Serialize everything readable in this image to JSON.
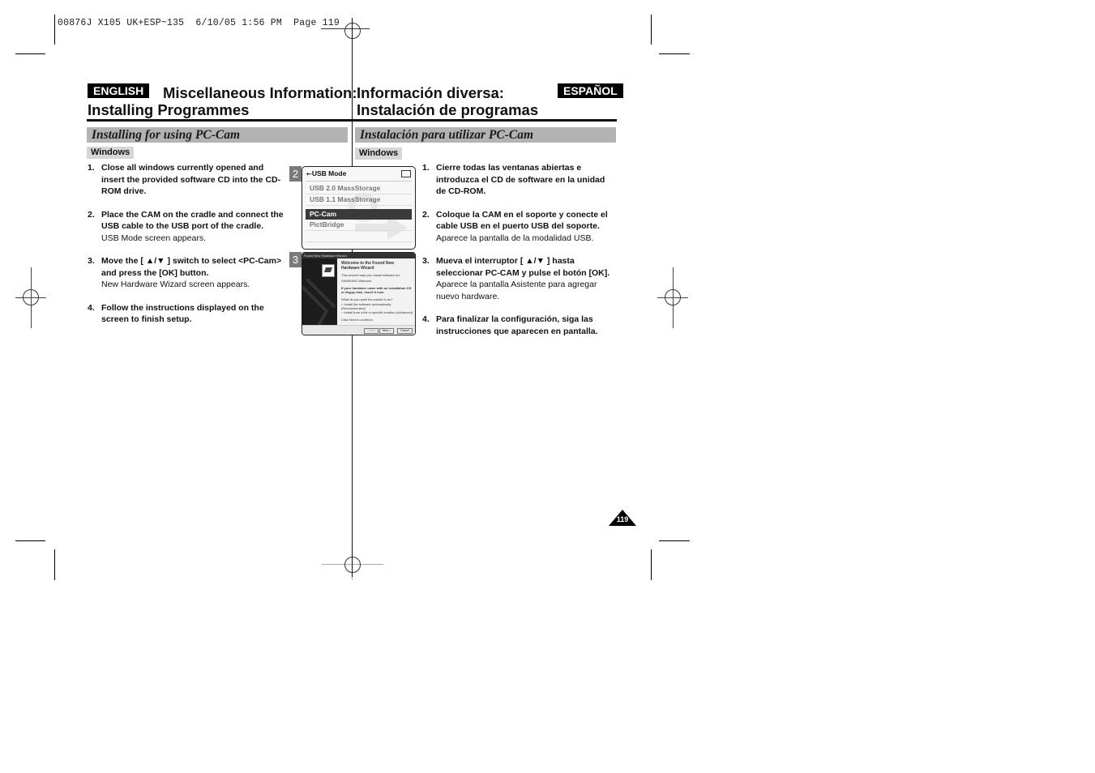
{
  "slug": {
    "text": "00876J X105 UK+ESP~135  6/10/05 1:56 PM  Page 119"
  },
  "english": {
    "badge": "ENGLISH",
    "title_line1": "Miscellaneous Information:",
    "title_line2": "Installing Programmes",
    "section": "Installing for using PC-Cam",
    "os_tag": "Windows",
    "steps": [
      {
        "num": "1.",
        "main": "Close all windows currently opened and insert the provided software CD into the CD-ROM drive.",
        "sub": ""
      },
      {
        "num": "2.",
        "main": "Place the CAM on the cradle and connect the USB cable to the USB port of the cradle.",
        "sub": "USB Mode screen appears."
      },
      {
        "num": "3.",
        "main": "Move the [ ▲/▼ ] switch to select <PC-Cam> and press the [OK] button.",
        "sub": "New Hardware Wizard screen appears."
      },
      {
        "num": "4.",
        "main": "Follow the instructions displayed on the screen to finish setup.",
        "sub": ""
      }
    ]
  },
  "spanish": {
    "badge": "ESPAÑOL",
    "title_line1": "Información diversa:",
    "title_line2": "Instalación de programas",
    "section": "Instalación para utilizar PC-Cam",
    "os_tag": "Windows",
    "steps": [
      {
        "num": "1.",
        "main": "Cierre todas las ventanas abiertas e introduzca el CD de software en la unidad de CD-ROM.",
        "sub": ""
      },
      {
        "num": "2.",
        "main": "Coloque la CAM en el soporte y conecte el cable USB en el puerto USB del soporte.",
        "sub": "Aparece la pantalla de la modalidad USB."
      },
      {
        "num": "3.",
        "main": "Mueva el interruptor [ ▲/▼ ] hasta seleccionar PC-CAM y pulse el botón [OK].",
        "sub": "Aparece la pantalla Asistente para agregar nuevo hardware."
      },
      {
        "num": "4.",
        "main": "Para finalizar la configuración, siga las instrucciones que aparecen en pantalla.",
        "sub": ""
      }
    ]
  },
  "figure2": {
    "num": "2",
    "header": "USB Mode",
    "usb_icon": "usb-icon",
    "items": [
      "USB 2.0 MassStorage",
      "USB 1.1 MassStorage",
      "PC-Cam",
      "PictBridge"
    ],
    "selected": "PC-Cam"
  },
  "figure3": {
    "num": "3",
    "window_title": "Found New Hardware Wizard",
    "heading": "Welcome to the Found New Hardware Wizard",
    "line1": "This wizard helps you install software for:",
    "device": "SAMSUNG Webcam",
    "cd_hint": "If your hardware came with an installation CD or floppy disk, insert it now.",
    "question": "What do you want the wizard to do?",
    "option1": "Install the software automatically (Recommended)",
    "option2": "Install from a list or specific location (Advanced)",
    "continue": "Click Next to continue.",
    "buttons": [
      "< Back",
      "Next >",
      "Cancel"
    ]
  },
  "page": {
    "number": "119"
  }
}
